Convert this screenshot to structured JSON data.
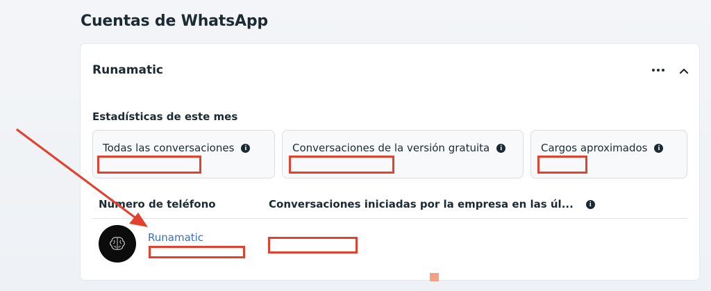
{
  "page": {
    "title": "Cuentas de WhatsApp"
  },
  "account": {
    "name": "Runamatic",
    "more_icon": "more-horizontal-icon",
    "collapse_icon": "chevron-up-icon"
  },
  "stats": {
    "title": "Estadísticas de este mes",
    "boxes": [
      {
        "label": "Todas las conversaciones",
        "icon": "info-icon",
        "value": ""
      },
      {
        "label": "Conversaciones de la versión gratuita",
        "icon": "info-icon",
        "value": ""
      },
      {
        "label": "Cargos aproximados",
        "icon": "info-icon",
        "value": ""
      }
    ]
  },
  "table": {
    "headers": [
      "Número de teléfono",
      "Conversaciones iniciadas por la empresa en las úl..."
    ],
    "rows": [
      {
        "display_name": "Runamatic",
        "phone_number": "",
        "conversations": ""
      }
    ]
  },
  "annotation": {
    "color": "#e2412d"
  }
}
